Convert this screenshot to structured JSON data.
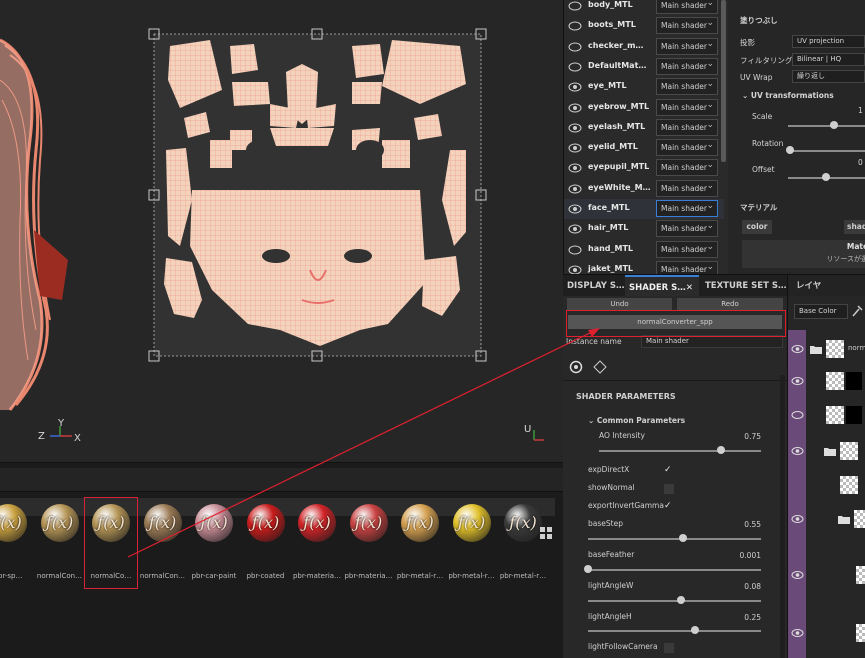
{
  "viewport3d": {
    "axes": {
      "y": "Y",
      "z": "Z",
      "x": "X"
    }
  },
  "viewport2d": {
    "axis_u": "U"
  },
  "shelf": {
    "items": [
      {
        "label": "pbr-sp…",
        "color": "#c8a040"
      },
      {
        "label": "normalCon…",
        "color": "#b59556"
      },
      {
        "label": "normalCo…",
        "color": "#b59556"
      },
      {
        "label": "normalCon…",
        "color": "#9a7a55"
      },
      {
        "label": "pbr-car-paint",
        "color": "#c78c96"
      },
      {
        "label": "pbr-coated",
        "color": "#c81c1c"
      },
      {
        "label": "pbr-materia…",
        "color": "#d02428"
      },
      {
        "label": "pbr-materia…",
        "color": "#c84242"
      },
      {
        "label": "pbr-metal-r…",
        "color": "#d4a050"
      },
      {
        "label": "pbr-metal-r…",
        "color": "#e0c02a"
      },
      {
        "label": "pbr-metal-r…",
        "color": "#3a3a3a"
      }
    ],
    "selected_index": 2
  },
  "materials": {
    "rows": [
      {
        "name": "body_MTL",
        "shader": "Main shader"
      },
      {
        "name": "boots_MTL",
        "shader": "Main shader"
      },
      {
        "name": "checker_m…",
        "shader": "Main shader"
      },
      {
        "name": "DefaultMat…",
        "shader": "Main shader"
      },
      {
        "name": "eye_MTL",
        "shader": "Main shader"
      },
      {
        "name": "eyebrow_MTL",
        "shader": "Main shader"
      },
      {
        "name": "eyelash_MTL",
        "shader": "Main shader"
      },
      {
        "name": "eyelid_MTL",
        "shader": "Main shader"
      },
      {
        "name": "eyepupil_MTL",
        "shader": "Main shader"
      },
      {
        "name": "eyeWhite_M…",
        "shader": "Main shader"
      },
      {
        "name": "face_MTL",
        "shader": "Main shader"
      },
      {
        "name": "hair_MTL",
        "shader": "Main shader"
      },
      {
        "name": "hand_MTL",
        "shader": "Main shader"
      },
      {
        "name": "jaket_MTL",
        "shader": "Main shader"
      }
    ],
    "active_index": 10
  },
  "props": {
    "section_title": "塗りつぶし",
    "projection_label": "投影",
    "projection_value": "UV projection",
    "filtering_label": "フィルタリング",
    "filtering_value": "Bilinear | HQ",
    "uvwrap_label": "UV Wrap",
    "uvwrap_value": "繰り返し",
    "uv_transform_title": "UV transformations",
    "scale_label": "Scale",
    "scale_value": "1",
    "rotation_label": "Rotation",
    "offset_label": "Offset",
    "offset_value": "0",
    "material_title": "マテリアル",
    "color_btn": "color",
    "shader_btn": "shad",
    "material_box_title": "Material",
    "material_box_sub": "リソースが選択さ"
  },
  "tabs": {
    "display": "DISPLAY S…",
    "shader": "SHADER S…",
    "close": "✕",
    "texture": "TEXTURE SET S…",
    "layers": "レイヤ"
  },
  "shader": {
    "undo": "Undo",
    "redo": "Redo",
    "shader_name": "normalConverter_spp",
    "instance_label": "Instance name",
    "instance_value": "Main shader",
    "section_title": "SHADER PARAMETERS",
    "group_title": "Common Parameters",
    "ao_label": "AO Intensity",
    "ao_value": "0.75",
    "ao_fraction": 0.75,
    "exp_direct_x": "expDirectX",
    "show_normal": "showNormal",
    "export_invert_gamma": "exportInvertGamma",
    "base_step_label": "baseStep",
    "base_step_value": "0.55",
    "base_step_fraction": 0.55,
    "base_feather_label": "baseFeather",
    "base_feather_value": "0.001",
    "base_feather_fraction": 0.001,
    "light_angle_w_label": "lightAngleW",
    "light_angle_w_value": "0.08",
    "light_angle_w_fraction": 0.54,
    "light_angle_h_label": "lightAngleH",
    "light_angle_h_value": "0.25",
    "light_angle_h_fraction": 0.62,
    "light_follow_camera": "lightFollowCamera"
  },
  "layers": {
    "blend_mode": "Base Color",
    "first_layer_name": "norm"
  },
  "colors": {
    "accent": "#3a7fd6",
    "annotation": "#e0202f",
    "uv_skin": "#f4d3bd",
    "uv_wire": "#e8706a"
  }
}
